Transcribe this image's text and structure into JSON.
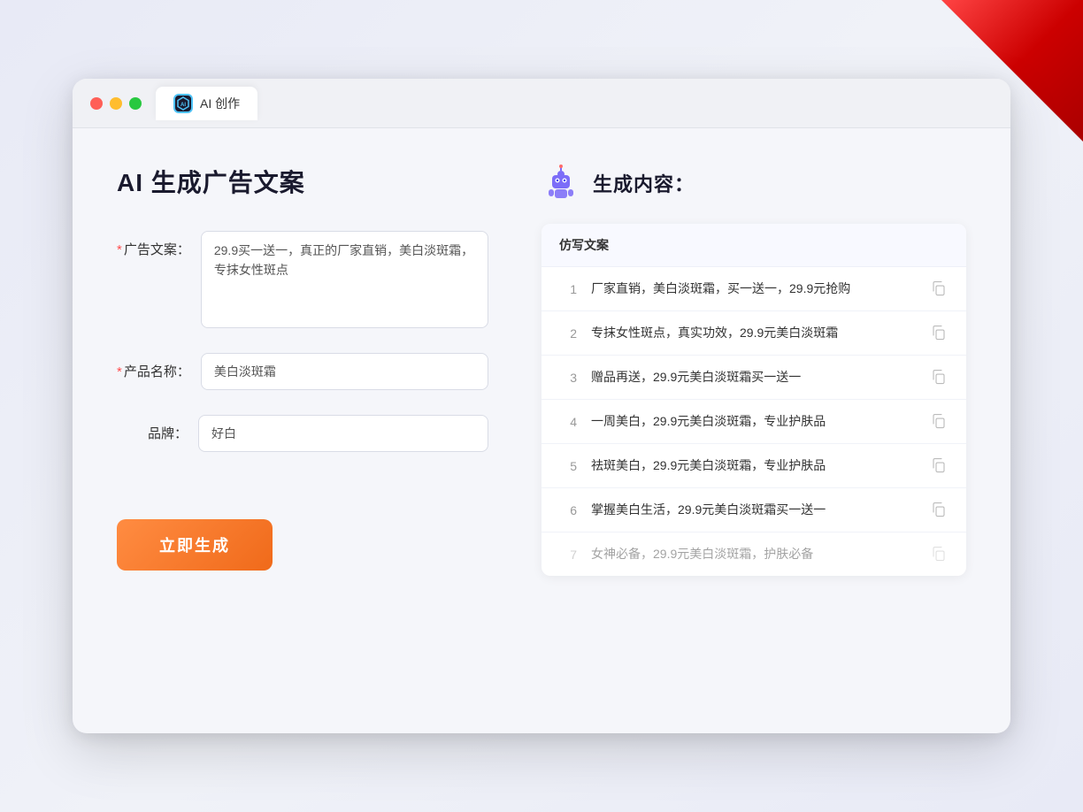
{
  "browser": {
    "tab_label": "AI 创作",
    "tab_icon_text": "AI"
  },
  "left_panel": {
    "page_title": "AI 生成广告文案",
    "form": {
      "ad_copy_label": "广告文案：",
      "ad_copy_required": "*",
      "ad_copy_value": "29.9买一送一，真正的厂家直销，美白淡斑霜，专抹女性斑点",
      "product_name_label": "产品名称：",
      "product_name_required": "*",
      "product_name_value": "美白淡斑霜",
      "brand_label": "品牌：",
      "brand_value": "好白"
    },
    "generate_button": "立即生成"
  },
  "right_panel": {
    "title": "生成内容：",
    "table_header": "仿写文案",
    "results": [
      {
        "id": 1,
        "text": "厂家直销，美白淡斑霜，买一送一，29.9元抢购",
        "faded": false
      },
      {
        "id": 2,
        "text": "专抹女性斑点，真实功效，29.9元美白淡斑霜",
        "faded": false
      },
      {
        "id": 3,
        "text": "赠品再送，29.9元美白淡斑霜买一送一",
        "faded": false
      },
      {
        "id": 4,
        "text": "一周美白，29.9元美白淡斑霜，专业护肤品",
        "faded": false
      },
      {
        "id": 5,
        "text": "祛斑美白，29.9元美白淡斑霜，专业护肤品",
        "faded": false
      },
      {
        "id": 6,
        "text": "掌握美白生活，29.9元美白淡斑霜买一送一",
        "faded": false
      },
      {
        "id": 7,
        "text": "女神必备，29.9元美白淡斑霜，护肤必备",
        "faded": true
      }
    ]
  },
  "traffic_lights": {
    "red": "#ff5f57",
    "yellow": "#ffbd2e",
    "green": "#28c840"
  }
}
